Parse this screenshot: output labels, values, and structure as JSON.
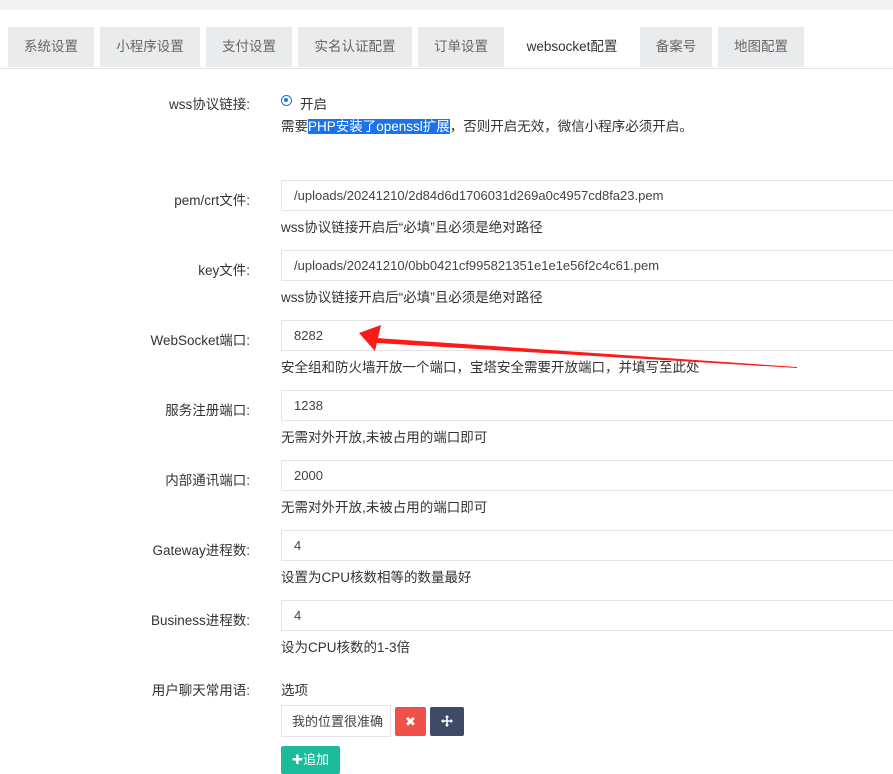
{
  "tabs": [
    "系统设置",
    "小程序设置",
    "支付设置",
    "实名认证配置",
    "订单设置",
    "websocket配置",
    "备案号",
    "地图配置"
  ],
  "active_tab": "websocket配置",
  "wss": {
    "label": "wss协议链接:",
    "option": "开启",
    "help_pre": "需要",
    "help_highlight": "PHP安装了openssl扩展",
    "help_post": "，否则开启无效，微信小程序必须开启。"
  },
  "pem": {
    "label": "pem/crt文件:",
    "value": "/uploads/20241210/2d84d6d1706031d269a0c4957cd8fa23.pem",
    "help": "wss协议链接开启后“必填”且必须是绝对路径"
  },
  "key": {
    "label": "key文件:",
    "value": "/uploads/20241210/0bb0421cf995821351e1e1e56f2c4c61.pem",
    "help": "wss协议链接开启后“必填”且必须是绝对路径"
  },
  "ws_port": {
    "label": "WebSocket端口:",
    "value": "8282",
    "help": "安全组和防火墙开放一个端口，宝塔安全需要开放端口，并填写至此处"
  },
  "register_port": {
    "label": "服务注册端口:",
    "value": "1238",
    "help": "无需对外开放,未被占用的端口即可"
  },
  "inner_port": {
    "label": "内部通讯端口:",
    "value": "2000",
    "help": "无需对外开放,未被占用的端口即可"
  },
  "gateway": {
    "label": "Gateway进程数:",
    "value": "4",
    "help": "设置为CPU核数相等的数量最好"
  },
  "business": {
    "label": "Business进程数:",
    "value": "4",
    "help": "设为CPU核数的1-3倍"
  },
  "phrases": {
    "label": "用户聊天常用语:",
    "header": "选项",
    "items": [
      "我的位置很准确"
    ],
    "add_label": "追加"
  },
  "icons": {
    "delete": "times-icon",
    "move": "arrows-move-icon",
    "add": "plus-icon"
  },
  "colors": {
    "accent": "#1a73e8",
    "danger": "#f0504a",
    "dark": "#3f4a66",
    "success": "#1cbb9b",
    "annotation": "#ff1a1a"
  }
}
